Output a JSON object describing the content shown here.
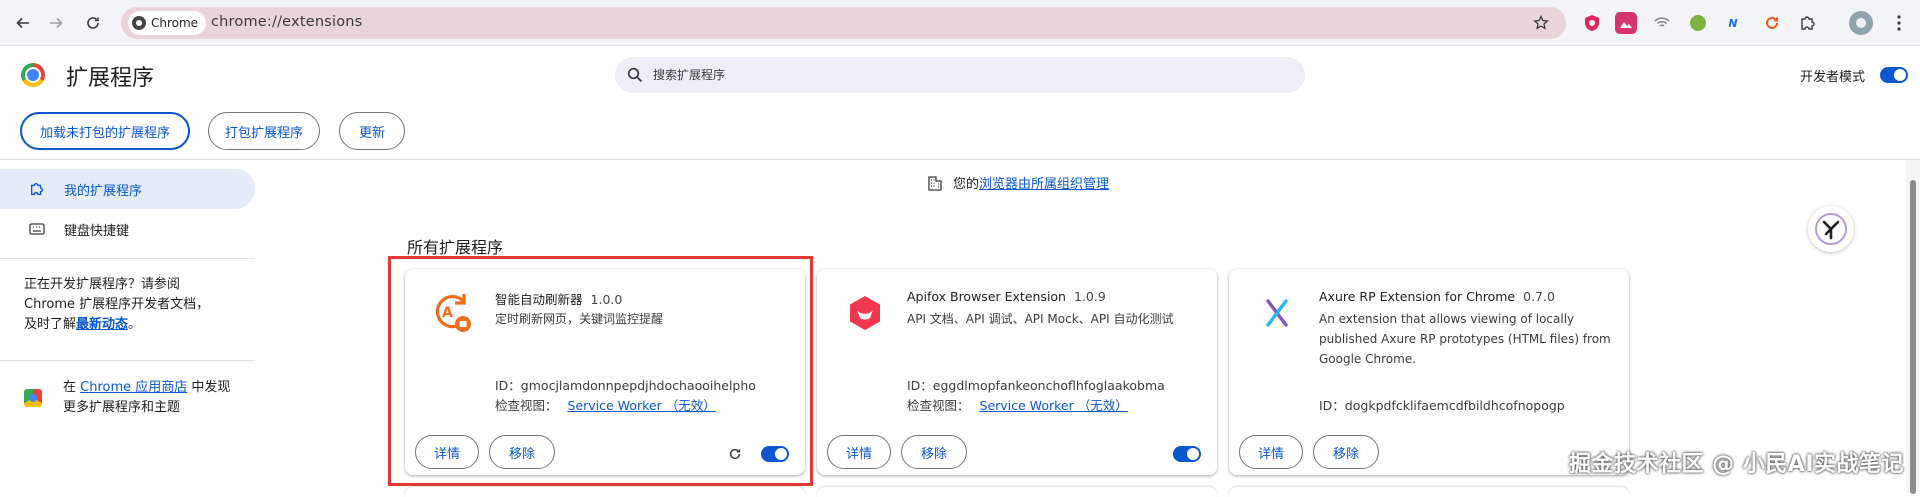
{
  "browser": {
    "chip_label": "Chrome",
    "url": "chrome://extensions",
    "extension_icons": [
      "shield-ext-icon",
      "mountain-ext-icon",
      "wifi-ext-icon",
      "circle-ext-icon",
      "n-ext-icon",
      "refresh-ext-icon",
      "puzzle-icon"
    ]
  },
  "header": {
    "title": "扩展程序",
    "search_placeholder": "搜索扩展程序",
    "dev_mode_label": "开发者模式",
    "dev_mode_on": true
  },
  "actions": {
    "load_unpacked": "加载未打包的扩展程序",
    "pack": "打包扩展程序",
    "update": "更新"
  },
  "sidebar": {
    "items": [
      {
        "label": "我的扩展程序",
        "icon": "puzzle-icon",
        "active": true
      },
      {
        "label": "键盘快捷键",
        "icon": "keyboard-icon",
        "active": false
      }
    ],
    "dev_note_prefix": "正在开发扩展程序？请参阅 Chrome 扩展程序开发者文档，及时了解",
    "dev_note_link": "最新动态",
    "dev_note_suffix": "。",
    "store_prefix": "在 ",
    "store_link": "Chrome 应用商店",
    "store_suffix": " 中发现更多扩展程序和主题"
  },
  "main": {
    "managed_prefix": "您的",
    "managed_link": "浏览器由所属组织管理",
    "section_title": "所有扩展程序",
    "cards": [
      {
        "name": "智能自动刷新器",
        "version": "1.0.0",
        "description": "定时刷新网页，关键词监控提醒",
        "id": "ID：gmocjlamdonnpepdjhdochaooihelpho",
        "view_label": "检查视图：",
        "view_link": "Service Worker （无效）",
        "details": "详情",
        "remove": "移除",
        "enabled": true,
        "has_reload": true
      },
      {
        "name": "Apifox Browser Extension",
        "version": "1.0.9",
        "description": "API 文档、API 调试、API Mock、API 自动化测试",
        "id": "ID：eggdlmopfankeonchoflhfoglaakobma",
        "view_label": "检查视图：",
        "view_link": "Service Worker （无效）",
        "details": "详情",
        "remove": "移除",
        "enabled": true,
        "has_reload": false
      },
      {
        "name": "Axure RP Extension for Chrome",
        "version": "0.7.0",
        "description": "An extension that allows viewing of locally published Axure RP prototypes (HTML files) from Google Chrome.",
        "id": "ID：dogkpdfcklifaemcdfbildhcofnopogp",
        "details": "详情",
        "remove": "移除"
      }
    ]
  },
  "watermark": "掘金技术社区 @ 小民AI实战笔记",
  "colors": {
    "accent": "#0b57d0",
    "highlight": "#e53935",
    "omnibox": "#e9d5d9"
  }
}
